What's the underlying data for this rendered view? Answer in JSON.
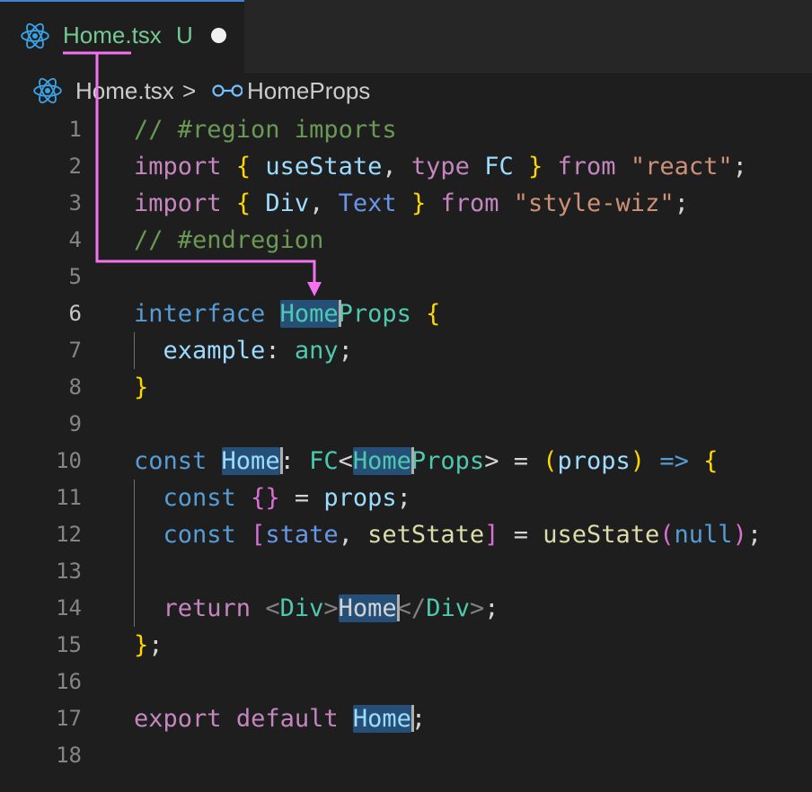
{
  "tab": {
    "filename": "Home.tsx",
    "status": "U",
    "icon": "react-icon",
    "dirty_indicator": "dot"
  },
  "breadcrumb": {
    "file": "Home.tsx",
    "separator": ">",
    "symbol_icon": "interface-symbol-icon",
    "symbol": "HomeProps"
  },
  "editor": {
    "active_line": "6",
    "line_numbers": [
      "1",
      "2",
      "3",
      "4",
      "5",
      "6",
      "7",
      "8",
      "9",
      "10",
      "11",
      "12",
      "13",
      "14",
      "15",
      "16",
      "17",
      "18"
    ],
    "lines": [
      [
        {
          "t": "// #region imports",
          "c": "cm"
        }
      ],
      [
        {
          "t": "import",
          "c": "kw"
        },
        {
          "t": " "
        },
        {
          "t": "{",
          "c": "b1"
        },
        {
          "t": " "
        },
        {
          "t": "useState",
          "c": "vr"
        },
        {
          "t": ", "
        },
        {
          "t": "type",
          "c": "kw"
        },
        {
          "t": " "
        },
        {
          "t": "FC",
          "c": "vr"
        },
        {
          "t": " "
        },
        {
          "t": "}",
          "c": "b1"
        },
        {
          "t": " "
        },
        {
          "t": "from",
          "c": "kw"
        },
        {
          "t": " "
        },
        {
          "t": "\"react\"",
          "c": "str"
        },
        {
          "t": ";"
        }
      ],
      [
        {
          "t": "import",
          "c": "kw"
        },
        {
          "t": " "
        },
        {
          "t": "{",
          "c": "b1"
        },
        {
          "t": " "
        },
        {
          "t": "Div",
          "c": "vr"
        },
        {
          "t": ", "
        },
        {
          "t": "Text",
          "c": "st"
        },
        {
          "t": " "
        },
        {
          "t": "}",
          "c": "b1"
        },
        {
          "t": " "
        },
        {
          "t": "from",
          "c": "kw"
        },
        {
          "t": " "
        },
        {
          "t": "\"style-wiz\"",
          "c": "str"
        },
        {
          "t": ";"
        }
      ],
      [
        {
          "t": "// #endregion",
          "c": "cm"
        }
      ],
      [],
      [
        {
          "t": "interface",
          "c": "kb"
        },
        {
          "t": " "
        },
        {
          "t": "Home",
          "c": "ty",
          "hl": true
        },
        {
          "cursor": true
        },
        {
          "t": "Props",
          "c": "ty"
        },
        {
          "t": " "
        },
        {
          "t": "{",
          "c": "b1"
        }
      ],
      [
        {
          "t": "  "
        },
        {
          "t": "example",
          "c": "vr"
        },
        {
          "t": ": "
        },
        {
          "t": "any",
          "c": "ty"
        },
        {
          "t": ";"
        }
      ],
      [
        {
          "t": "}",
          "c": "b1"
        }
      ],
      [],
      [
        {
          "t": "const",
          "c": "kb"
        },
        {
          "t": " "
        },
        {
          "t": "Home",
          "c": "vr",
          "hl": true
        },
        {
          "cursor": true
        },
        {
          "t": ": "
        },
        {
          "t": "FC",
          "c": "ty"
        },
        {
          "t": "<",
          "c": "pl"
        },
        {
          "t": "Home",
          "c": "ty",
          "hl": true
        },
        {
          "cursor": true
        },
        {
          "t": "Props",
          "c": "ty"
        },
        {
          "t": ">",
          "c": "pl"
        },
        {
          "t": " = "
        },
        {
          "t": "(",
          "c": "b1"
        },
        {
          "t": "props",
          "c": "vr"
        },
        {
          "t": ")",
          "c": "b1"
        },
        {
          "t": " "
        },
        {
          "t": "=>",
          "c": "kb"
        },
        {
          "t": " "
        },
        {
          "t": "{",
          "c": "b1"
        }
      ],
      [
        {
          "t": "  "
        },
        {
          "t": "const",
          "c": "kb"
        },
        {
          "t": " "
        },
        {
          "t": "{}",
          "c": "b2"
        },
        {
          "t": " = "
        },
        {
          "t": "props",
          "c": "vr"
        },
        {
          "t": ";"
        }
      ],
      [
        {
          "t": "  "
        },
        {
          "t": "const",
          "c": "kb"
        },
        {
          "t": " "
        },
        {
          "t": "[",
          "c": "b2"
        },
        {
          "t": "state",
          "c": "st"
        },
        {
          "t": ", "
        },
        {
          "t": "setState",
          "c": "fn"
        },
        {
          "t": "]",
          "c": "b2"
        },
        {
          "t": " = "
        },
        {
          "t": "useState",
          "c": "fn"
        },
        {
          "t": "(",
          "c": "b2"
        },
        {
          "t": "null",
          "c": "kb"
        },
        {
          "t": ")",
          "c": "b2"
        },
        {
          "t": ";"
        }
      ],
      [],
      [
        {
          "t": "  "
        },
        {
          "t": "return",
          "c": "kw"
        },
        {
          "t": " "
        },
        {
          "t": "<",
          "c": "tag"
        },
        {
          "t": "Div",
          "c": "ty"
        },
        {
          "t": ">",
          "c": "tag"
        },
        {
          "t": "Home",
          "c": "pl",
          "hl": true
        },
        {
          "cursor": true
        },
        {
          "t": "</",
          "c": "tag"
        },
        {
          "t": "Div",
          "c": "ty"
        },
        {
          "t": ">",
          "c": "tag"
        },
        {
          "t": ";"
        }
      ],
      [
        {
          "t": "}",
          "c": "b1"
        },
        {
          "t": ";"
        }
      ],
      [],
      [
        {
          "t": "export",
          "c": "kw"
        },
        {
          "t": " "
        },
        {
          "t": "default",
          "c": "kw"
        },
        {
          "t": " "
        },
        {
          "t": "Home",
          "c": "vr",
          "hl": true
        },
        {
          "cursor": true
        },
        {
          "t": ";"
        }
      ],
      []
    ]
  },
  "annotation": {
    "color": "#f472f0",
    "description_icon": "arrow-from-tab-to-symbol"
  }
}
